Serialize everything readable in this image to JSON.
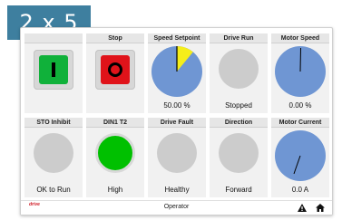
{
  "badge": "2 x 5",
  "tiles": {
    "start": {
      "title": "",
      "symbol": "I"
    },
    "stop": {
      "title": "Stop",
      "symbol": "O"
    },
    "speed_setpoint": {
      "title": "Speed Setpoint",
      "value": "50.00 %",
      "fraction": 0.5
    },
    "drive_run": {
      "title": "Drive Run",
      "state": "Stopped"
    },
    "motor_speed": {
      "title": "Motor Speed",
      "value": "0.00 %",
      "fraction": 0.0
    },
    "sto_inhibit": {
      "title": "STO Inhibit",
      "state": "OK to Run"
    },
    "din1_t2": {
      "title": "DIN1 T2",
      "state": "High"
    },
    "drive_fault": {
      "title": "Drive Fault",
      "state": "Healthy"
    },
    "direction": {
      "title": "Direction",
      "state": "Forward"
    },
    "motor_current": {
      "title": "Motor Current",
      "value": "0.0 A",
      "fraction": 0.0
    }
  },
  "footer": {
    "brand": "drive",
    "title": "Operator"
  },
  "colors": {
    "gauge_fill": "#6f96d3",
    "setpoint_sector": "#f5ee1a",
    "lamp_on": "#00c000",
    "lamp_off": "#cccccc",
    "start_button": "#10b13a",
    "stop_button": "#e0131a",
    "badge": "#3e7f9f"
  },
  "icons": {
    "warning": "warning-icon",
    "home": "home-icon"
  }
}
